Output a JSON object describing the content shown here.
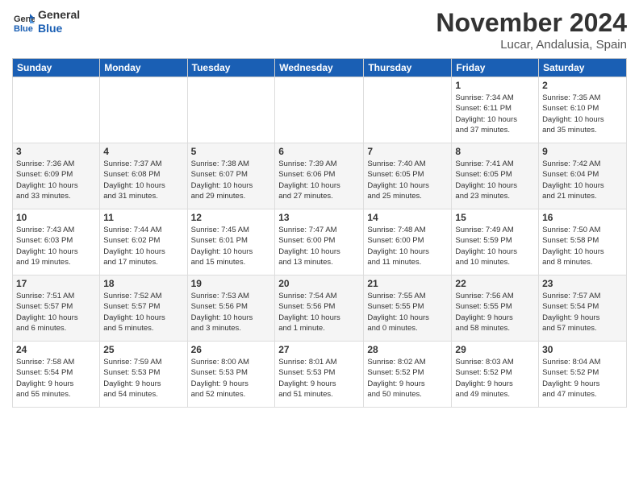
{
  "logo": {
    "line1": "General",
    "line2": "Blue"
  },
  "header": {
    "month": "November 2024",
    "location": "Lucar, Andalusia, Spain"
  },
  "days_of_week": [
    "Sunday",
    "Monday",
    "Tuesday",
    "Wednesday",
    "Thursday",
    "Friday",
    "Saturday"
  ],
  "weeks": [
    [
      {
        "day": "",
        "info": ""
      },
      {
        "day": "",
        "info": ""
      },
      {
        "day": "",
        "info": ""
      },
      {
        "day": "",
        "info": ""
      },
      {
        "day": "",
        "info": ""
      },
      {
        "day": "1",
        "info": "Sunrise: 7:34 AM\nSunset: 6:11 PM\nDaylight: 10 hours\nand 37 minutes."
      },
      {
        "day": "2",
        "info": "Sunrise: 7:35 AM\nSunset: 6:10 PM\nDaylight: 10 hours\nand 35 minutes."
      }
    ],
    [
      {
        "day": "3",
        "info": "Sunrise: 7:36 AM\nSunset: 6:09 PM\nDaylight: 10 hours\nand 33 minutes."
      },
      {
        "day": "4",
        "info": "Sunrise: 7:37 AM\nSunset: 6:08 PM\nDaylight: 10 hours\nand 31 minutes."
      },
      {
        "day": "5",
        "info": "Sunrise: 7:38 AM\nSunset: 6:07 PM\nDaylight: 10 hours\nand 29 minutes."
      },
      {
        "day": "6",
        "info": "Sunrise: 7:39 AM\nSunset: 6:06 PM\nDaylight: 10 hours\nand 27 minutes."
      },
      {
        "day": "7",
        "info": "Sunrise: 7:40 AM\nSunset: 6:05 PM\nDaylight: 10 hours\nand 25 minutes."
      },
      {
        "day": "8",
        "info": "Sunrise: 7:41 AM\nSunset: 6:05 PM\nDaylight: 10 hours\nand 23 minutes."
      },
      {
        "day": "9",
        "info": "Sunrise: 7:42 AM\nSunset: 6:04 PM\nDaylight: 10 hours\nand 21 minutes."
      }
    ],
    [
      {
        "day": "10",
        "info": "Sunrise: 7:43 AM\nSunset: 6:03 PM\nDaylight: 10 hours\nand 19 minutes."
      },
      {
        "day": "11",
        "info": "Sunrise: 7:44 AM\nSunset: 6:02 PM\nDaylight: 10 hours\nand 17 minutes."
      },
      {
        "day": "12",
        "info": "Sunrise: 7:45 AM\nSunset: 6:01 PM\nDaylight: 10 hours\nand 15 minutes."
      },
      {
        "day": "13",
        "info": "Sunrise: 7:47 AM\nSunset: 6:00 PM\nDaylight: 10 hours\nand 13 minutes."
      },
      {
        "day": "14",
        "info": "Sunrise: 7:48 AM\nSunset: 6:00 PM\nDaylight: 10 hours\nand 11 minutes."
      },
      {
        "day": "15",
        "info": "Sunrise: 7:49 AM\nSunset: 5:59 PM\nDaylight: 10 hours\nand 10 minutes."
      },
      {
        "day": "16",
        "info": "Sunrise: 7:50 AM\nSunset: 5:58 PM\nDaylight: 10 hours\nand 8 minutes."
      }
    ],
    [
      {
        "day": "17",
        "info": "Sunrise: 7:51 AM\nSunset: 5:57 PM\nDaylight: 10 hours\nand 6 minutes."
      },
      {
        "day": "18",
        "info": "Sunrise: 7:52 AM\nSunset: 5:57 PM\nDaylight: 10 hours\nand 5 minutes."
      },
      {
        "day": "19",
        "info": "Sunrise: 7:53 AM\nSunset: 5:56 PM\nDaylight: 10 hours\nand 3 minutes."
      },
      {
        "day": "20",
        "info": "Sunrise: 7:54 AM\nSunset: 5:56 PM\nDaylight: 10 hours\nand 1 minute."
      },
      {
        "day": "21",
        "info": "Sunrise: 7:55 AM\nSunset: 5:55 PM\nDaylight: 10 hours\nand 0 minutes."
      },
      {
        "day": "22",
        "info": "Sunrise: 7:56 AM\nSunset: 5:55 PM\nDaylight: 9 hours\nand 58 minutes."
      },
      {
        "day": "23",
        "info": "Sunrise: 7:57 AM\nSunset: 5:54 PM\nDaylight: 9 hours\nand 57 minutes."
      }
    ],
    [
      {
        "day": "24",
        "info": "Sunrise: 7:58 AM\nSunset: 5:54 PM\nDaylight: 9 hours\nand 55 minutes."
      },
      {
        "day": "25",
        "info": "Sunrise: 7:59 AM\nSunset: 5:53 PM\nDaylight: 9 hours\nand 54 minutes."
      },
      {
        "day": "26",
        "info": "Sunrise: 8:00 AM\nSunset: 5:53 PM\nDaylight: 9 hours\nand 52 minutes."
      },
      {
        "day": "27",
        "info": "Sunrise: 8:01 AM\nSunset: 5:53 PM\nDaylight: 9 hours\nand 51 minutes."
      },
      {
        "day": "28",
        "info": "Sunrise: 8:02 AM\nSunset: 5:52 PM\nDaylight: 9 hours\nand 50 minutes."
      },
      {
        "day": "29",
        "info": "Sunrise: 8:03 AM\nSunset: 5:52 PM\nDaylight: 9 hours\nand 49 minutes."
      },
      {
        "day": "30",
        "info": "Sunrise: 8:04 AM\nSunset: 5:52 PM\nDaylight: 9 hours\nand 47 minutes."
      }
    ]
  ]
}
